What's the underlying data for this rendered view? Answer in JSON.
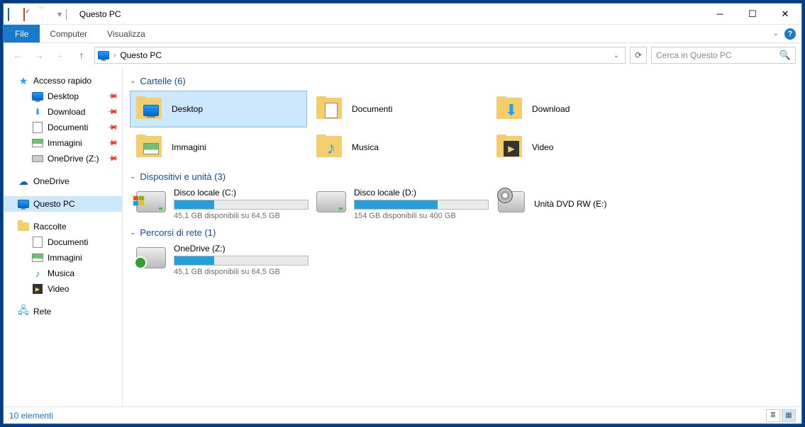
{
  "window": {
    "title": "Questo PC"
  },
  "ribbon": {
    "file": "File",
    "tabs": [
      "Computer",
      "Visualizza"
    ]
  },
  "address": {
    "crumb": "Questo PC"
  },
  "search": {
    "placeholder": "Cerca in Questo PC"
  },
  "sidebar": {
    "quick_access": "Accesso rapido",
    "quick_items": [
      {
        "label": "Desktop"
      },
      {
        "label": "Download"
      },
      {
        "label": "Documenti"
      },
      {
        "label": "Immagini"
      },
      {
        "label": "OneDrive (Z:)"
      }
    ],
    "onedrive": "OneDrive",
    "this_pc": "Questo PC",
    "libraries": "Raccolte",
    "lib_items": [
      {
        "label": "Documenti"
      },
      {
        "label": "Immagini"
      },
      {
        "label": "Musica"
      },
      {
        "label": "Video"
      }
    ],
    "network": "Rete"
  },
  "groups": {
    "folders": {
      "label": "Cartelle (6)"
    },
    "drives": {
      "label": "Dispositivi e unità (3)"
    },
    "network": {
      "label": "Percorsi di rete (1)"
    }
  },
  "folders": [
    {
      "label": "Desktop"
    },
    {
      "label": "Documenti"
    },
    {
      "label": "Download"
    },
    {
      "label": "Immagini"
    },
    {
      "label": "Musica"
    },
    {
      "label": "Video"
    }
  ],
  "drives": [
    {
      "name": "Disco locale (C:)",
      "free_text": "45,1 GB disponibili su 64,5 GB",
      "fill_pct": 30
    },
    {
      "name": "Disco locale (D:)",
      "free_text": "154 GB disponibili su 400 GB",
      "fill_pct": 62
    },
    {
      "name": "Unità DVD RW (E:)",
      "free_text": "",
      "fill_pct": null
    }
  ],
  "netlocs": [
    {
      "name": "OneDrive (Z:)",
      "free_text": "45,1 GB disponibili su 64,5 GB",
      "fill_pct": 30
    }
  ],
  "status": {
    "count": "10 elementi"
  }
}
